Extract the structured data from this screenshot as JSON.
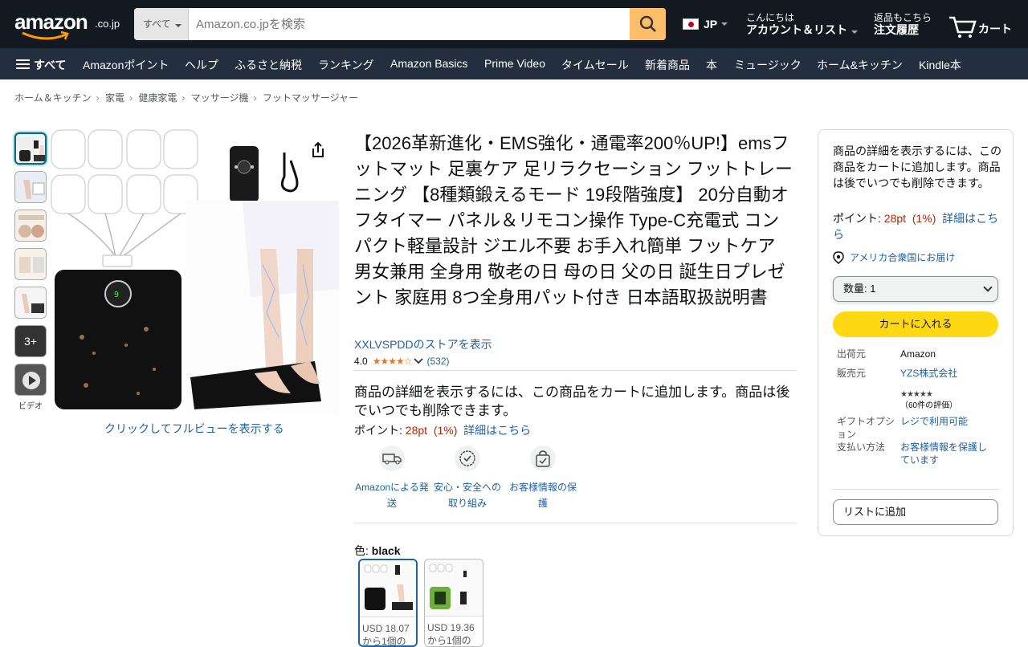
{
  "header": {
    "logo_text": "amazon",
    "logo_suffix": ".co.jp",
    "search_category": "すべて",
    "search_placeholder": "Amazon.co.jpを検索",
    "lang": "JP",
    "account_line1": "こんにちは",
    "account_line2": "アカウント＆リスト",
    "orders_line1": "返品もこちら",
    "orders_line2": "注文履歴",
    "cart_label": "カート"
  },
  "navbar": {
    "all": "すべて",
    "items": [
      "Amazonポイント",
      "ヘルプ",
      "ふるさと納税",
      "ランキング",
      "Amazon Basics",
      "Prime Video",
      "タイムセール",
      "新着商品",
      "本",
      "ミュージック",
      "ホーム&キッチン",
      "Kindle本"
    ]
  },
  "breadcrumb": [
    "ホーム＆キッチン",
    "家電",
    "健康家電",
    "マッサージ機",
    "フットマッサージャー"
  ],
  "gallery": {
    "more_count": "3+",
    "video_label": "ビデオ",
    "fullview": "クリックしてフルビューを表示する"
  },
  "product": {
    "title": "【2026革新進化・EMS強化・通電率200％UP!】emsフットマット 足裏ケア 足リラクセーション フットトレーニング 【8種類鍛えるモード 19段階強度】 20分自動オフタイマー パネル＆リモコン操作 Type-C充電式 コンパクト軽量設計 ジエル不要 お手入れ簡単 フットケア 男女兼用 全身用 敬老の日 母の日 父の日 誕生日プレゼント 家庭用 8つ全身用パット付き 日本語取扱説明書",
    "store": "XXLVSPDDのストアを表示",
    "rating": "4.0",
    "stars": "★★★★☆",
    "review_count": "(532)",
    "desc": "商品の詳細を表示するには、この商品をカートに追加します。商品は後でいつでも削除できます。",
    "points_label": "ポイント: ",
    "points_value": "28pt",
    "points_pct": "(1%)",
    "points_link": "詳細はこちら",
    "badges": [
      "Amazonによる発送",
      "安心・安全への取り組み",
      "お客様情報の保護"
    ],
    "color_label": "色: ",
    "color_value": "black",
    "swatches": [
      {
        "price": "USD 18.07",
        "sub": "から1個の"
      },
      {
        "price": "USD 19.36",
        "sub": "から1個の"
      }
    ]
  },
  "buybox": {
    "text": "商品の詳細を表示するには、この商品をカートに追加します。商品は後でいつでも削除できます。",
    "points_label": "ポイント: ",
    "points_value": "28pt",
    "points_pct": "(1%)",
    "points_link": "詳細はこちら",
    "location": "アメリカ合衆国にお届け",
    "qty": "数量: 1",
    "add_to_cart": "カートに入れる",
    "shipper_label": "出荷元",
    "shipper_value": "Amazon",
    "seller_label": "販売元",
    "seller_value": "YZS株式会社",
    "seller_rating": "（60件の評価）",
    "seller_stars": "★★★★★",
    "gift_label": "ギフトオプション",
    "gift_value": "レジで利用可能",
    "payment_label": "支払い方法",
    "payment_value": "お客様情報を保護しています",
    "add_to_list": "リストに追加"
  },
  "colors": {
    "header_bg": "#131921",
    "nav_bg": "#232f3e",
    "search_btn": "#febd69",
    "cart_btn": "#ffd814",
    "link": "#2162a1",
    "price_red": "#b12704",
    "star": "#de7921"
  }
}
